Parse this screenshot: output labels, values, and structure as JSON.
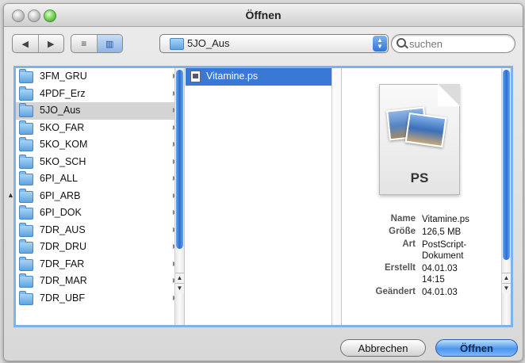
{
  "window": {
    "title": "Öffnen"
  },
  "toolbar": {
    "back_icon": "back-arrow-icon",
    "forward_icon": "forward-arrow-icon",
    "list_view_icon": "list-view-icon",
    "column_view_icon": "column-view-icon",
    "location": "5JO_Aus",
    "search_placeholder": "suchen"
  },
  "columns": {
    "col1": [
      {
        "label": "3FM_GRU"
      },
      {
        "label": "4PDF_Erz"
      },
      {
        "label": "5JO_Aus",
        "selected": true
      },
      {
        "label": "5KO_FAR"
      },
      {
        "label": "5KO_KOM"
      },
      {
        "label": "5KO_SCH"
      },
      {
        "label": "6PI_ALL"
      },
      {
        "label": "6PI_ARB"
      },
      {
        "label": "6PI_DOK"
      },
      {
        "label": "7DR_AUS"
      },
      {
        "label": "7DR_DRU"
      },
      {
        "label": "7DR_FAR"
      },
      {
        "label": "7DR_MAR"
      },
      {
        "label": "7DR_UBF"
      }
    ],
    "col2": [
      {
        "label": "Vitamine.ps",
        "selected": true
      }
    ]
  },
  "preview": {
    "badge": "PS",
    "info": [
      {
        "key": "Name",
        "value": "Vitamine.ps"
      },
      {
        "key": "Größe",
        "value": "126,5 MB"
      },
      {
        "key": "Art",
        "value": "PostScript-Dokument"
      },
      {
        "key": "Erstellt",
        "value": "04.01.03 14:15"
      },
      {
        "key": "Geändert",
        "value": "04.01.03"
      }
    ]
  },
  "buttons": {
    "cancel": "Abbrechen",
    "open": "Öffnen"
  },
  "colors": {
    "accent": "#3a78d6",
    "focus_ring": "#7fb2e8"
  }
}
